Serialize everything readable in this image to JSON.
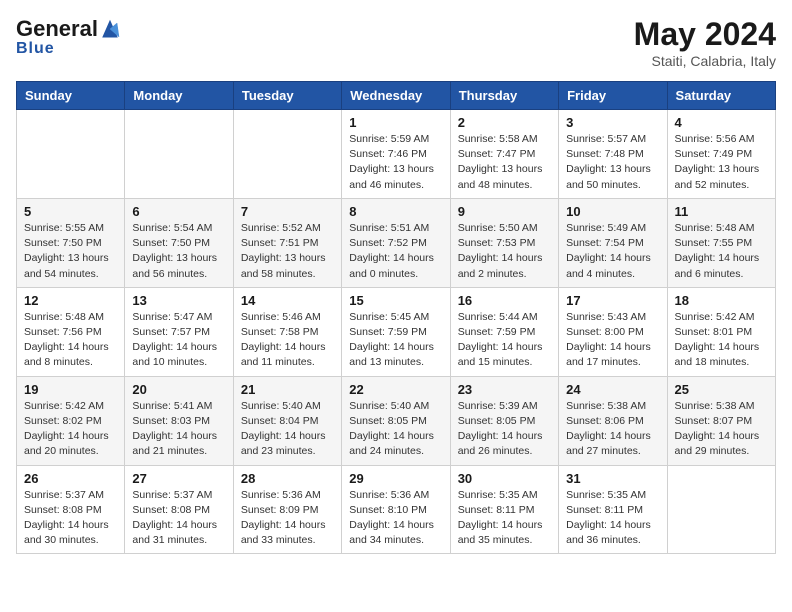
{
  "header": {
    "logo_general": "General",
    "logo_blue": "Blue",
    "month_year": "May 2024",
    "location": "Staiti, Calabria, Italy"
  },
  "days_of_week": [
    "Sunday",
    "Monday",
    "Tuesday",
    "Wednesday",
    "Thursday",
    "Friday",
    "Saturday"
  ],
  "weeks": [
    {
      "days": [
        {
          "number": "",
          "info": ""
        },
        {
          "number": "",
          "info": ""
        },
        {
          "number": "",
          "info": ""
        },
        {
          "number": "1",
          "info": "Sunrise: 5:59 AM\nSunset: 7:46 PM\nDaylight: 13 hours\nand 46 minutes."
        },
        {
          "number": "2",
          "info": "Sunrise: 5:58 AM\nSunset: 7:47 PM\nDaylight: 13 hours\nand 48 minutes."
        },
        {
          "number": "3",
          "info": "Sunrise: 5:57 AM\nSunset: 7:48 PM\nDaylight: 13 hours\nand 50 minutes."
        },
        {
          "number": "4",
          "info": "Sunrise: 5:56 AM\nSunset: 7:49 PM\nDaylight: 13 hours\nand 52 minutes."
        }
      ]
    },
    {
      "days": [
        {
          "number": "5",
          "info": "Sunrise: 5:55 AM\nSunset: 7:50 PM\nDaylight: 13 hours\nand 54 minutes."
        },
        {
          "number": "6",
          "info": "Sunrise: 5:54 AM\nSunset: 7:50 PM\nDaylight: 13 hours\nand 56 minutes."
        },
        {
          "number": "7",
          "info": "Sunrise: 5:52 AM\nSunset: 7:51 PM\nDaylight: 13 hours\nand 58 minutes."
        },
        {
          "number": "8",
          "info": "Sunrise: 5:51 AM\nSunset: 7:52 PM\nDaylight: 14 hours\nand 0 minutes."
        },
        {
          "number": "9",
          "info": "Sunrise: 5:50 AM\nSunset: 7:53 PM\nDaylight: 14 hours\nand 2 minutes."
        },
        {
          "number": "10",
          "info": "Sunrise: 5:49 AM\nSunset: 7:54 PM\nDaylight: 14 hours\nand 4 minutes."
        },
        {
          "number": "11",
          "info": "Sunrise: 5:48 AM\nSunset: 7:55 PM\nDaylight: 14 hours\nand 6 minutes."
        }
      ]
    },
    {
      "days": [
        {
          "number": "12",
          "info": "Sunrise: 5:48 AM\nSunset: 7:56 PM\nDaylight: 14 hours\nand 8 minutes."
        },
        {
          "number": "13",
          "info": "Sunrise: 5:47 AM\nSunset: 7:57 PM\nDaylight: 14 hours\nand 10 minutes."
        },
        {
          "number": "14",
          "info": "Sunrise: 5:46 AM\nSunset: 7:58 PM\nDaylight: 14 hours\nand 11 minutes."
        },
        {
          "number": "15",
          "info": "Sunrise: 5:45 AM\nSunset: 7:59 PM\nDaylight: 14 hours\nand 13 minutes."
        },
        {
          "number": "16",
          "info": "Sunrise: 5:44 AM\nSunset: 7:59 PM\nDaylight: 14 hours\nand 15 minutes."
        },
        {
          "number": "17",
          "info": "Sunrise: 5:43 AM\nSunset: 8:00 PM\nDaylight: 14 hours\nand 17 minutes."
        },
        {
          "number": "18",
          "info": "Sunrise: 5:42 AM\nSunset: 8:01 PM\nDaylight: 14 hours\nand 18 minutes."
        }
      ]
    },
    {
      "days": [
        {
          "number": "19",
          "info": "Sunrise: 5:42 AM\nSunset: 8:02 PM\nDaylight: 14 hours\nand 20 minutes."
        },
        {
          "number": "20",
          "info": "Sunrise: 5:41 AM\nSunset: 8:03 PM\nDaylight: 14 hours\nand 21 minutes."
        },
        {
          "number": "21",
          "info": "Sunrise: 5:40 AM\nSunset: 8:04 PM\nDaylight: 14 hours\nand 23 minutes."
        },
        {
          "number": "22",
          "info": "Sunrise: 5:40 AM\nSunset: 8:05 PM\nDaylight: 14 hours\nand 24 minutes."
        },
        {
          "number": "23",
          "info": "Sunrise: 5:39 AM\nSunset: 8:05 PM\nDaylight: 14 hours\nand 26 minutes."
        },
        {
          "number": "24",
          "info": "Sunrise: 5:38 AM\nSunset: 8:06 PM\nDaylight: 14 hours\nand 27 minutes."
        },
        {
          "number": "25",
          "info": "Sunrise: 5:38 AM\nSunset: 8:07 PM\nDaylight: 14 hours\nand 29 minutes."
        }
      ]
    },
    {
      "days": [
        {
          "number": "26",
          "info": "Sunrise: 5:37 AM\nSunset: 8:08 PM\nDaylight: 14 hours\nand 30 minutes."
        },
        {
          "number": "27",
          "info": "Sunrise: 5:37 AM\nSunset: 8:08 PM\nDaylight: 14 hours\nand 31 minutes."
        },
        {
          "number": "28",
          "info": "Sunrise: 5:36 AM\nSunset: 8:09 PM\nDaylight: 14 hours\nand 33 minutes."
        },
        {
          "number": "29",
          "info": "Sunrise: 5:36 AM\nSunset: 8:10 PM\nDaylight: 14 hours\nand 34 minutes."
        },
        {
          "number": "30",
          "info": "Sunrise: 5:35 AM\nSunset: 8:11 PM\nDaylight: 14 hours\nand 35 minutes."
        },
        {
          "number": "31",
          "info": "Sunrise: 5:35 AM\nSunset: 8:11 PM\nDaylight: 14 hours\nand 36 minutes."
        },
        {
          "number": "",
          "info": ""
        }
      ]
    }
  ]
}
